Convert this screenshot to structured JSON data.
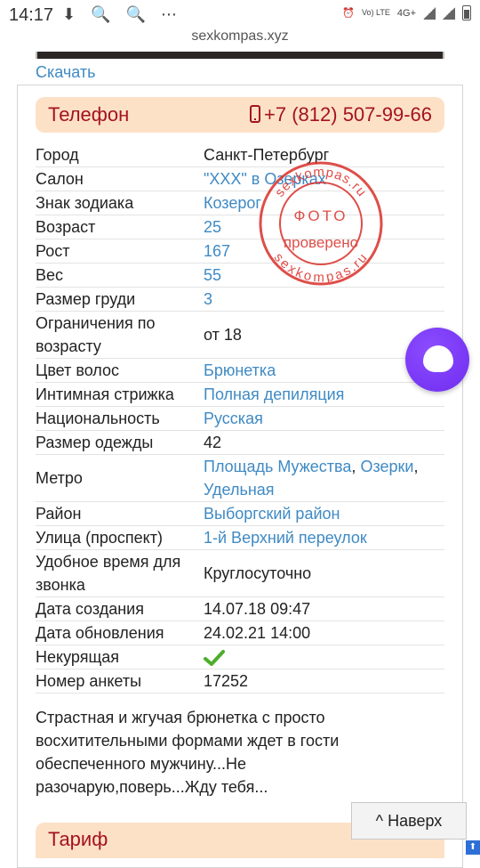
{
  "status": {
    "time": "14:17",
    "left_icons": "⬇ 🔍 🔍 ⋯",
    "vo_lte": "Vo)\nLTE",
    "net": "4G+"
  },
  "url": "sexkompas.xyz",
  "download_label": "Скачать",
  "phone": {
    "label": "Телефон",
    "number": "+7 (812) 507-99-66"
  },
  "rows": [
    {
      "k": "Город",
      "v": "Санкт-Петербург"
    },
    {
      "k": "Салон",
      "v": "\"XXX\" в Озерках"
    },
    {
      "k": "Знак зодиака",
      "v": "Козерог"
    },
    {
      "k": "Возраст",
      "v": "25"
    },
    {
      "k": "Рост",
      "v": "167"
    },
    {
      "k": "Вес",
      "v": "55"
    },
    {
      "k": "Размер груди",
      "v": "3"
    },
    {
      "k": "Ограничения по возрасту",
      "v": "от 18"
    },
    {
      "k": "Цвет волос",
      "v": "Брюнетка"
    },
    {
      "k": "Интимная стрижка",
      "v": "Полная депиляция"
    },
    {
      "k": "Национальность",
      "v": "Русская"
    },
    {
      "k": "Размер одежды",
      "v": "42"
    },
    {
      "k": "Метро",
      "v1": "Площадь Мужества",
      "v2": "Озерки",
      "v3": "Удельная"
    },
    {
      "k": "Район",
      "v": "Выборгский район"
    },
    {
      "k": "Улица (проспект)",
      "v": "1-й Верхний переулок"
    },
    {
      "k": "Удобное время для звонка",
      "v": "Круглосуточно"
    },
    {
      "k": "Дата создания",
      "v": "14.07.18 09:47"
    },
    {
      "k": "Дата обновления",
      "v": "24.02.21 14:00"
    },
    {
      "k": "Некурящая",
      "icon": "checkmark-icon"
    },
    {
      "k": "Номер анкеты",
      "v": "17252"
    }
  ],
  "stamp": {
    "top": "sexkompas.ru",
    "mid1": "ФОТО",
    "mid2": "проверено",
    "bottom": "sexkompas.ru"
  },
  "description": "Страстная и жгучая брюнетка с просто восхитительными формами ждет в гости обеспеченного мужчину...Не разочарую,поверь...Жду тебя...",
  "tariff_label": "Тариф",
  "to_top_label": "^ Наверх",
  "colors": {
    "accent": "#a4131e",
    "link": "#3f8ac4",
    "header_bg": "#fde1c7",
    "stamp": "#d9302a",
    "alice": "#7b3cf5"
  }
}
